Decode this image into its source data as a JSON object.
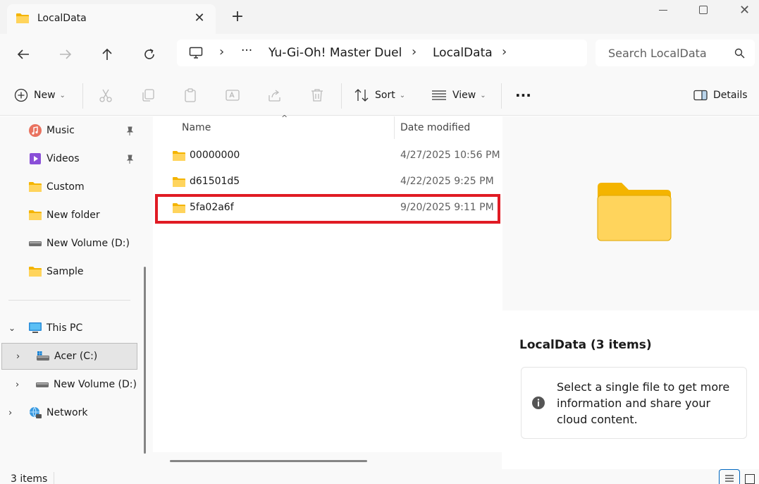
{
  "tab": {
    "title": "LocalData"
  },
  "address": {
    "ellipsis": "···",
    "crumbs": [
      "Yu-Gi-Oh!  Master Duel",
      "LocalData"
    ]
  },
  "search": {
    "placeholder": "Search LocalData"
  },
  "toolbar": {
    "new_label": "New",
    "sort_label": "Sort",
    "view_label": "View",
    "more_label": "···",
    "details_label": "Details"
  },
  "sidebar": {
    "items": [
      {
        "label": "Music",
        "icon": "music-icon"
      },
      {
        "label": "Videos",
        "icon": "videos-icon"
      },
      {
        "label": "Custom",
        "icon": "folder-icon"
      },
      {
        "label": "New folder",
        "icon": "folder-icon"
      },
      {
        "label": "New Volume (D:)",
        "icon": "drive-icon"
      },
      {
        "label": "Sample",
        "icon": "folder-icon"
      },
      {
        "label": "This PC",
        "icon": "pc-icon"
      },
      {
        "label": "Acer (C:)",
        "icon": "windows-drive-icon"
      },
      {
        "label": "New Volume (D:)",
        "icon": "drive-icon"
      },
      {
        "label": "Network",
        "icon": "network-icon"
      }
    ]
  },
  "columns": {
    "name": "Name",
    "date": "Date modified"
  },
  "files": [
    {
      "name": "00000000",
      "date": "4/27/2025 10:56 PM"
    },
    {
      "name": "d61501d5",
      "date": "4/22/2025 9:25 PM"
    },
    {
      "name": "5fa02a6f",
      "date": "9/20/2025 9:11 PM"
    }
  ],
  "details": {
    "title": "LocalData (3 items)",
    "message": "Select a single file to get more information and share your cloud content."
  },
  "status": {
    "count": "3 items"
  },
  "colors": {
    "accent": "#0067c0",
    "highlight": "#e01b24",
    "folder": "#ffc83d"
  }
}
